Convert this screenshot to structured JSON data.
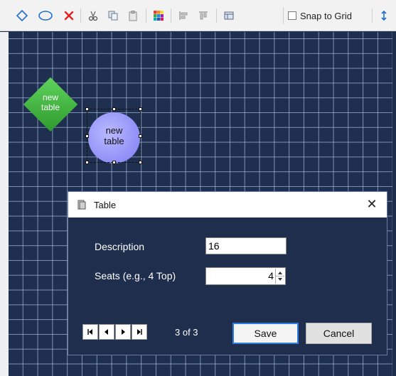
{
  "toolbar": {
    "tools": [
      {
        "icon": "diamond-shape-icon"
      },
      {
        "icon": "ellipse-shape-icon"
      },
      {
        "icon": "delete-icon"
      },
      {
        "icon": "cut-icon"
      },
      {
        "icon": "copy-icon"
      },
      {
        "icon": "paste-icon"
      },
      {
        "icon": "color-palette-icon"
      },
      {
        "icon": "align-left-icon"
      },
      {
        "icon": "align-top-icon"
      },
      {
        "icon": "table-view-icon"
      }
    ],
    "snap_label": "Snap to Grid",
    "overflow_icon": "more-arrow-icon"
  },
  "canvas": {
    "shapes": [
      {
        "type": "diamond",
        "label_line1": "new",
        "label_line2": "table",
        "color": "#3cb93a"
      },
      {
        "type": "circle",
        "label_line1": "new",
        "label_line2": "table",
        "color": "#9b9bff",
        "selected": true
      }
    ]
  },
  "dialog": {
    "title": "Table",
    "title_icon": "table-icon",
    "description_label": "Description",
    "description_value": "16",
    "seats_label": "Seats (e.g., 4 Top)",
    "seats_value": "4",
    "record_position": "3 of 3",
    "save_label": "Save",
    "cancel_label": "Cancel"
  },
  "colors": {
    "canvas_bg": "#1f2f4f",
    "grid_line": "#a8bcde",
    "delete_red": "#e02020",
    "shape_blue": "#1f6fd0"
  }
}
